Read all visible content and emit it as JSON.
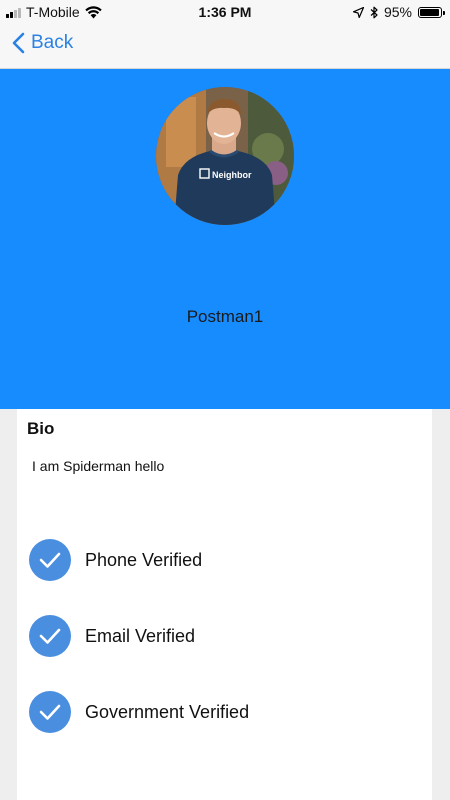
{
  "status_bar": {
    "carrier": "T-Mobile",
    "time": "1:36 PM",
    "battery": "95%",
    "battery_level": 0.95,
    "icons": [
      "signal-icon",
      "wifi-icon",
      "location-arrow-icon",
      "bluetooth-icon",
      "battery-icon"
    ]
  },
  "nav": {
    "back_label": "Back",
    "accent_color": "#2a82e4"
  },
  "profile": {
    "username": "Postman1",
    "avatar_shirt_text": "Neighbor",
    "header_color": "#178cff"
  },
  "bio": {
    "heading": "Bio",
    "text": "I am Spiderman hello"
  },
  "verifications": [
    {
      "label": "Phone Verified",
      "icon": "checkmark-icon"
    },
    {
      "label": "Email Verified",
      "icon": "checkmark-icon"
    },
    {
      "label": "Government Verified",
      "icon": "checkmark-icon"
    }
  ],
  "colors": {
    "check_circle": "#4a8fdf",
    "page_background": "#eeeeef"
  }
}
